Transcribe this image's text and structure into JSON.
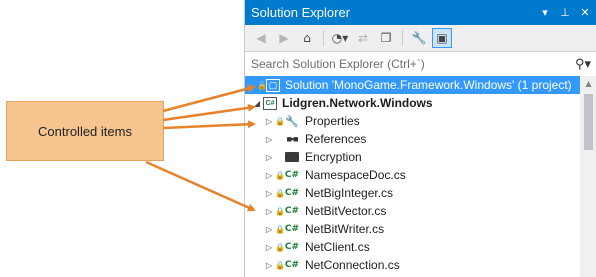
{
  "callout": {
    "label": "Controlled items"
  },
  "window": {
    "title": "Solution Explorer",
    "pin_icon": "pin-icon",
    "close_icon": "close-icon",
    "dropdown_icon": "dropdown-icon",
    "accent": "#007acc",
    "selection": "#3399ff",
    "arrow_color": "#e8822a"
  },
  "toolbar": {
    "buttons": [
      "back-icon",
      "forward-icon",
      "home-icon",
      "pending-changes-icon",
      "sync-icon",
      "collapse-all-icon",
      "properties-icon",
      "preview-icon"
    ]
  },
  "search": {
    "placeholder": "Search Solution Explorer (Ctrl+`)"
  },
  "tree": [
    {
      "label": "Solution 'MonoGame.Framework.Windows' (1 project)",
      "icon": "solution-icon"
    },
    {
      "label": "Lidgren.Network.Windows",
      "icon": "csharp-project-icon"
    },
    {
      "label": "Properties",
      "icon": "wrench-icon"
    },
    {
      "label": "References",
      "icon": "references-icon"
    },
    {
      "label": "Encryption",
      "icon": "folder-icon"
    },
    {
      "label": "NamespaceDoc.cs",
      "icon": "csharp-file-icon"
    },
    {
      "label": "NetBigInteger.cs",
      "icon": "csharp-file-icon"
    },
    {
      "label": "NetBitVector.cs",
      "icon": "csharp-file-icon"
    },
    {
      "label": "NetBitWriter.cs",
      "icon": "csharp-file-icon"
    },
    {
      "label": "NetClient.cs",
      "icon": "csharp-file-icon"
    },
    {
      "label": "NetConnection.cs",
      "icon": "csharp-file-icon"
    }
  ]
}
